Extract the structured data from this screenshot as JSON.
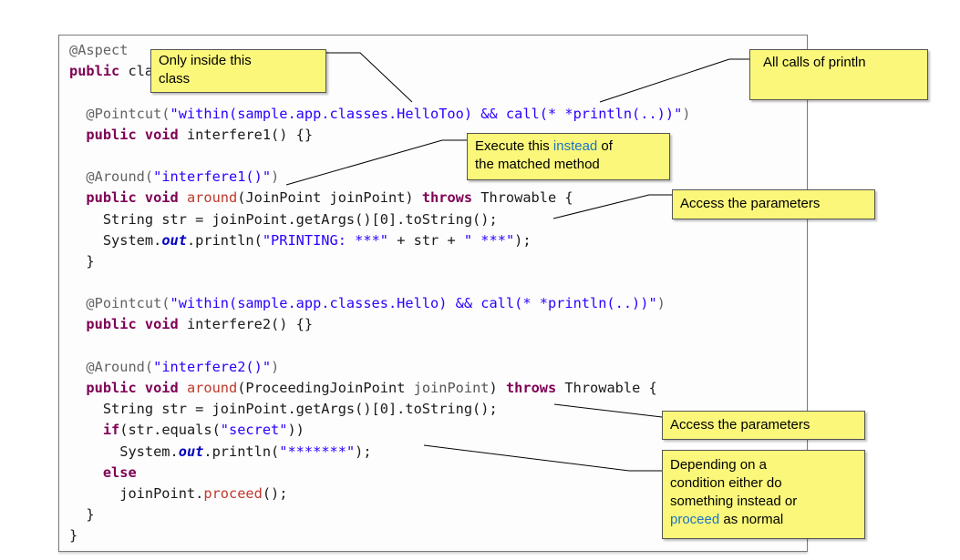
{
  "code": {
    "lines": [
      [
        {
          "t": "@Aspect",
          "c": "ann"
        }
      ],
      [
        {
          "t": "public",
          "c": "kw"
        },
        {
          "t": " class HelloAspect {",
          "c": ""
        }
      ],
      [],
      [
        {
          "t": "  @Pointcut(",
          "c": "ann"
        },
        {
          "t": "\"within(sample.app.classes.HelloToo) && call(* *println(..))\"",
          "c": "str"
        },
        {
          "t": ")",
          "c": "ann"
        }
      ],
      [
        {
          "t": "  ",
          "c": ""
        },
        {
          "t": "public void",
          "c": "kw"
        },
        {
          "t": " interfere1() {}",
          "c": ""
        }
      ],
      [],
      [
        {
          "t": "  @Around(",
          "c": "ann"
        },
        {
          "t": "\"interfere1()\"",
          "c": "str"
        },
        {
          "t": ")",
          "c": "ann"
        }
      ],
      [
        {
          "t": "  ",
          "c": ""
        },
        {
          "t": "public void",
          "c": "kw"
        },
        {
          "t": " ",
          "c": ""
        },
        {
          "t": "around",
          "c": "red"
        },
        {
          "t": "(JoinPoint joinPoint) ",
          "c": ""
        },
        {
          "t": "throws",
          "c": "kw"
        },
        {
          "t": " Throwable {",
          "c": ""
        }
      ],
      [
        {
          "t": "    String str = joinPoint.getArgs()[0].toString();",
          "c": ""
        }
      ],
      [
        {
          "t": "    System.",
          "c": ""
        },
        {
          "t": "out",
          "c": "field"
        },
        {
          "t": ".println(",
          "c": ""
        },
        {
          "t": "\"PRINTING: ***\"",
          "c": "str"
        },
        {
          "t": " + str + ",
          "c": ""
        },
        {
          "t": "\" ***\"",
          "c": "str"
        },
        {
          "t": ");",
          "c": ""
        }
      ],
      [
        {
          "t": "  }",
          "c": ""
        }
      ],
      [],
      [
        {
          "t": "  @Pointcut(",
          "c": "ann"
        },
        {
          "t": "\"within(sample.app.classes.Hello) && call(* *println(..))\"",
          "c": "str"
        },
        {
          "t": ")",
          "c": "ann"
        }
      ],
      [
        {
          "t": "  ",
          "c": ""
        },
        {
          "t": "public void",
          "c": "kw"
        },
        {
          "t": " interfere2() {}",
          "c": ""
        }
      ],
      [],
      [
        {
          "t": "  @Around(",
          "c": "ann"
        },
        {
          "t": "\"interfere2()\"",
          "c": "str"
        },
        {
          "t": ")",
          "c": "ann"
        }
      ],
      [
        {
          "t": "  ",
          "c": ""
        },
        {
          "t": "public void",
          "c": "kw"
        },
        {
          "t": " ",
          "c": ""
        },
        {
          "t": "around",
          "c": "red"
        },
        {
          "t": "(ProceedingJoinPoint ",
          "c": ""
        },
        {
          "t": "joinPoint",
          "c": "gray"
        },
        {
          "t": ") ",
          "c": ""
        },
        {
          "t": "throws",
          "c": "kw"
        },
        {
          "t": " Throwable {",
          "c": ""
        }
      ],
      [
        {
          "t": "    String str = joinPoint.getArgs()[0].toString();",
          "c": ""
        }
      ],
      [
        {
          "t": "    ",
          "c": ""
        },
        {
          "t": "if",
          "c": "kw"
        },
        {
          "t": "(str.equals(",
          "c": ""
        },
        {
          "t": "\"secret\"",
          "c": "str"
        },
        {
          "t": "))",
          "c": ""
        }
      ],
      [
        {
          "t": "      System.",
          "c": ""
        },
        {
          "t": "out",
          "c": "field"
        },
        {
          "t": ".println(",
          "c": ""
        },
        {
          "t": "\"*******\"",
          "c": "str"
        },
        {
          "t": ");",
          "c": ""
        }
      ],
      [
        {
          "t": "    ",
          "c": ""
        },
        {
          "t": "else",
          "c": "kw"
        }
      ],
      [
        {
          "t": "      joinPoint.",
          "c": ""
        },
        {
          "t": "proceed",
          "c": "red"
        },
        {
          "t": "();",
          "c": ""
        }
      ],
      [
        {
          "t": "  }",
          "c": ""
        }
      ],
      [
        {
          "t": "}",
          "c": ""
        }
      ]
    ]
  },
  "notes": {
    "within_class": {
      "line1": "Only inside this",
      "line2": "class"
    },
    "all_println": {
      "text": "All calls of println"
    },
    "instead": {
      "pre": "Execute this ",
      "highlight": "instead",
      "post": " of",
      "line2": "the matched method"
    },
    "params1": {
      "text": "Access the parameters"
    },
    "params2": {
      "text": "Access the parameters"
    },
    "condition": {
      "line1": "Depending on a",
      "line2": "condition either do",
      "line3": "something instead or",
      "highlight": "proceed",
      "post": " as normal"
    }
  }
}
